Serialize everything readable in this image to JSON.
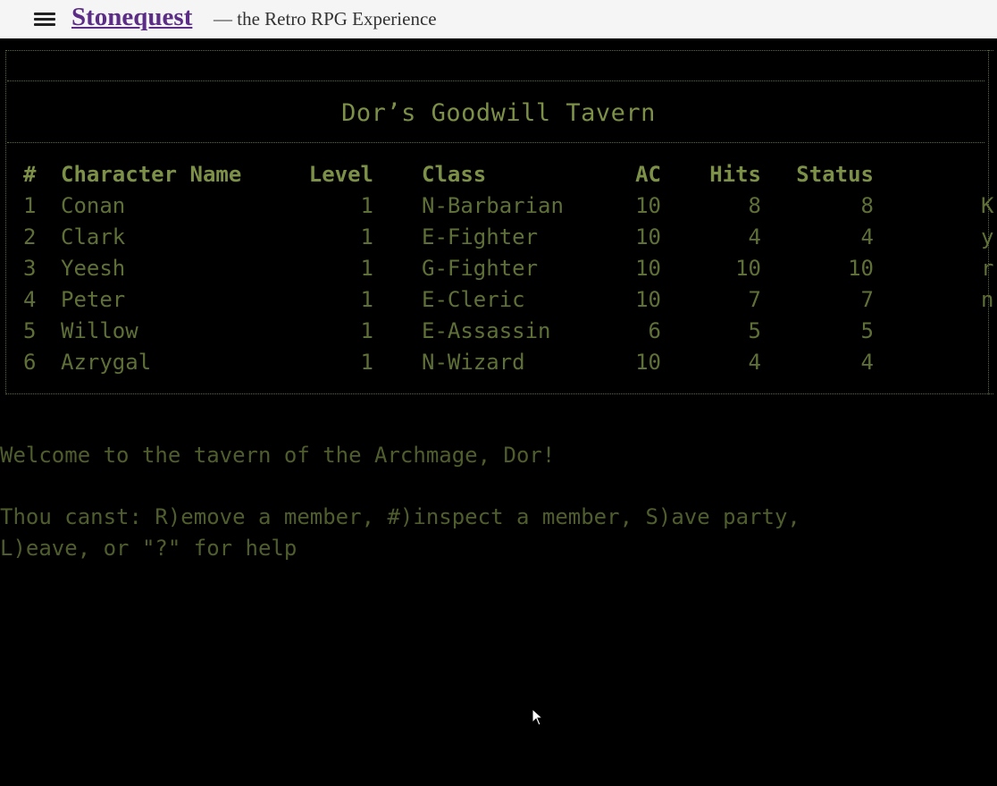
{
  "header": {
    "brand": "Stonequest",
    "tagline": "— the Retro RPG Experience"
  },
  "game": {
    "title": "Dor’s Goodwill Tavern",
    "columns": {
      "num": "#",
      "name": "Character Name",
      "level": "Level",
      "class": "Class",
      "ac": "AC",
      "hits": "Hits",
      "status": "Status"
    },
    "rows": [
      {
        "num": "1",
        "name": "Conan",
        "level": "1",
        "class": "N-Barbarian",
        "ac": "10",
        "hits": "8",
        "status": "8",
        "extra": "K"
      },
      {
        "num": "2",
        "name": "Clark",
        "level": "1",
        "class": "E-Fighter",
        "ac": "10",
        "hits": "4",
        "status": "4",
        "extra": "y"
      },
      {
        "num": "3",
        "name": "Yeesh",
        "level": "1",
        "class": "G-Fighter",
        "ac": "10",
        "hits": "10",
        "status": "10",
        "extra": "r"
      },
      {
        "num": "4",
        "name": "Peter",
        "level": "1",
        "class": "E-Cleric",
        "ac": "10",
        "hits": "7",
        "status": "7",
        "extra": "n"
      },
      {
        "num": "5",
        "name": "Willow",
        "level": "1",
        "class": "E-Assassin",
        "ac": "6",
        "hits": "5",
        "status": "5",
        "extra": ""
      },
      {
        "num": "6",
        "name": "Azrygal",
        "level": "1",
        "class": "N-Wizard",
        "ac": "10",
        "hits": "4",
        "status": "4",
        "extra": ""
      }
    ],
    "welcome": "Welcome to the tavern of the Archmage, Dor!",
    "prompt_line1": "Thou canst: R)emove a member, #)inspect a member, S)ave party,",
    "prompt_line2": "L)eave, or \"?\" for help"
  },
  "colors": {
    "phosphor": "#6f8040",
    "background": "#000000",
    "brand": "#5b2d87"
  }
}
